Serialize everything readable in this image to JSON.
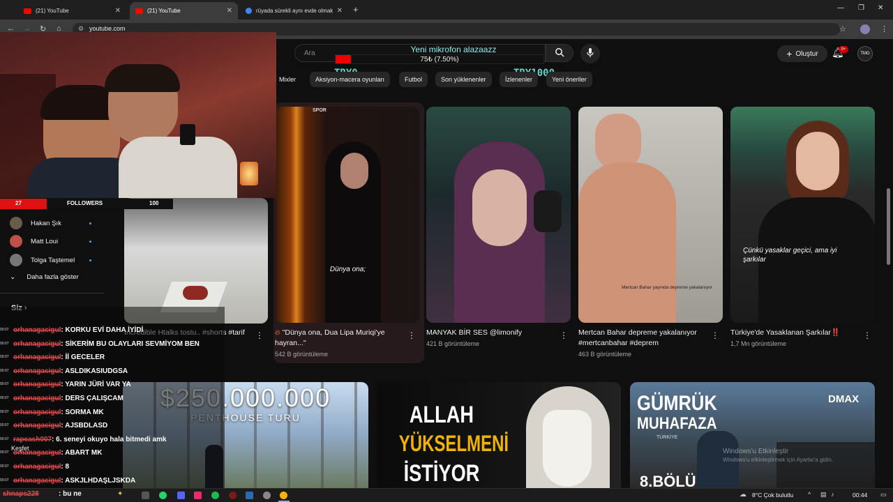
{
  "browser": {
    "tabs": [
      {
        "label": "(21) YouTube",
        "active": false
      },
      {
        "label": "(21) YouTube",
        "active": true
      },
      {
        "label": "rüyada sürekli aynı evde olmak",
        "active": false
      }
    ],
    "url": "youtube.com"
  },
  "youtube": {
    "search_placeholder": "Ara",
    "create_label": "Oluştur",
    "notif_count": "9+",
    "avatar_text": "TMG",
    "chips": [
      "Mixler",
      "Aksiyon-macera oyunları",
      "Futbol",
      "Son yüklenenler",
      "İzlenenler",
      "Yeni öneriler"
    ],
    "videos_row1": [
      {
        "title": "Incredible Htalks tostu.. #shorts #tarif",
        "views": ""
      },
      {
        "title": "\"Dünya ona, Dua Lipa Muriqi'ye hayran...\"",
        "views": "542 B görüntüleme",
        "overlay": "Dünya ona;",
        "tag": "SPOR"
      },
      {
        "title": "MANYAK BİR SES @limonify",
        "views": "421 B görüntüleme"
      },
      {
        "title": "Mertcan Bahar depreme yakalanıyor #mertcanbahar #deprem",
        "views": "463 B görüntüleme",
        "overlay": "Mertcan Bahar yayında depreme yakalanıyor"
      },
      {
        "title": "Türkiye'de Yasaklanan Şarkılar‼️",
        "views": "1,7 Mn görüntüleme",
        "overlay": "Çünkü yasaklar geçici, ama iyi şarkılar"
      }
    ],
    "videos_row2": [
      {
        "overlay_big": "$250.000.000",
        "overlay_small": "PENTHOUSE TURU"
      },
      {
        "overlay_line1": "ALLAH",
        "overlay_line2": "YÜKSELMENİ",
        "overlay_line3": "İSTİYOR"
      },
      {
        "overlay_line1": "GÜMRÜK",
        "overlay_line2": "MUHAFAZA",
        "overlay_line3": "TÜRKİYE",
        "overlay_line4": "8.BÖLÜM",
        "brand": "DMAX"
      }
    ],
    "windows_watermark": "Windows'u Etkinleştir",
    "windows_watermark_sub": "Windows'u etkinleştirmek için Ayarlar'a gidin."
  },
  "donation": {
    "title": "Yeni mikrofon alazaazz",
    "amount": "75₺ (7.50%)",
    "progress": 0.075,
    "min_label": "TRY0",
    "max_label": "TRY1000"
  },
  "followers": {
    "current": "27",
    "label": "FOLLOWERS",
    "target": "100",
    "progress": 0.27
  },
  "sidebar": {
    "subscriptions": [
      {
        "name": "Hakan Şık"
      },
      {
        "name": "Matt Loui"
      },
      {
        "name": "Tolga Taştemel"
      }
    ],
    "show_more": "Daha fazla göster",
    "you_label": "Siz",
    "discover_label": "Keşfet"
  },
  "chat": [
    {
      "user": "orhanagacigul",
      "msg": ": KORKU EVİ DAHA İYİDİ"
    },
    {
      "user": "orhanagacigul",
      "msg": ": SİKERİM BU OLAYLARI SEVMİYOM BEN"
    },
    {
      "user": "orhanagacigul",
      "msg": ": İİ GECELER"
    },
    {
      "user": "orhanagacigul",
      "msg": ": ASLDIKASIUDGSA"
    },
    {
      "user": "orhanagacigul",
      "msg": ": YARIN JÜRİ VAR YA"
    },
    {
      "user": "orhanagacigul",
      "msg": ": DERS ÇALIŞCAM"
    },
    {
      "user": "orhanagacigul",
      "msg": ": SORMA MK"
    },
    {
      "user": "orhanagacigul",
      "msg": ": AJSBDLASD"
    },
    {
      "user": "rapcash007",
      "msg": ": 6. seneyi okuyo hala bitmedi amk"
    },
    {
      "user": "orhanagacigul",
      "msg": ": ABART MK"
    },
    {
      "user": "orhanagacigul",
      "msg": ": 8"
    },
    {
      "user": "orhanagacigul",
      "msg": ": ASKJLHDAŞLJSKDA"
    }
  ],
  "chat_latest": {
    "user": "shnaps228",
    "msg": ": bu ne"
  },
  "chat_time": "00:07",
  "taskbar": {
    "weather": "8°C  Çok bulutlu",
    "clock": "00:44"
  }
}
